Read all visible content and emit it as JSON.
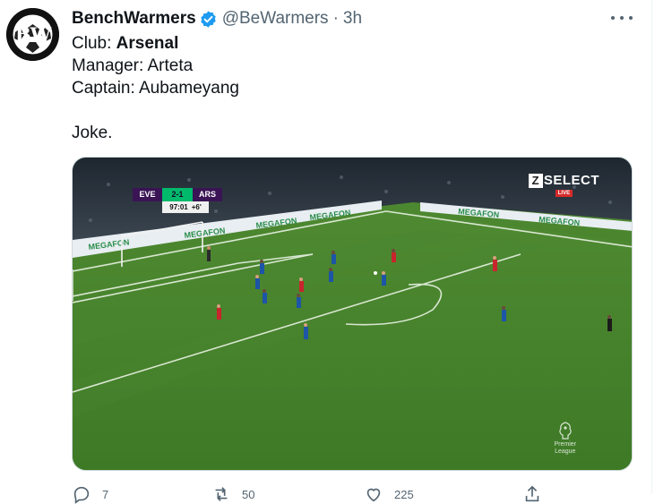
{
  "tweet": {
    "author": {
      "avatar_text": "BW",
      "display_name": "BenchWarmers",
      "verified": true,
      "handle": "@BeWarmers",
      "separator": "·",
      "timestamp": "3h"
    },
    "text_lines": [
      {
        "label": "Club: ",
        "value": "Arsenal",
        "bold_value": true
      },
      {
        "label": "Manager: Arteta"
      },
      {
        "label": "Captain: Aubameyang"
      },
      {
        "label": ""
      },
      {
        "label": "Joke."
      }
    ],
    "media": {
      "scorebug": {
        "home": "EVE",
        "score": "2-1",
        "away": "ARS",
        "clock": "97:01",
        "added_time": "+6'"
      },
      "broadcaster": {
        "logo": "SELECT",
        "live": "LIVE"
      },
      "league_mark": {
        "line1": "Premier",
        "line2": "League"
      }
    },
    "actions": [
      {
        "icon": "reply-icon",
        "count": "7"
      },
      {
        "icon": "retweet-icon",
        "count": "50"
      },
      {
        "icon": "like-icon",
        "count": "225"
      },
      {
        "icon": "share-icon",
        "count": ""
      }
    ]
  },
  "colors": {
    "text": "#0f1419",
    "secondary": "#536471",
    "verified_blue": "#1d9bf0",
    "pitch_green": "#3f7d2b"
  }
}
